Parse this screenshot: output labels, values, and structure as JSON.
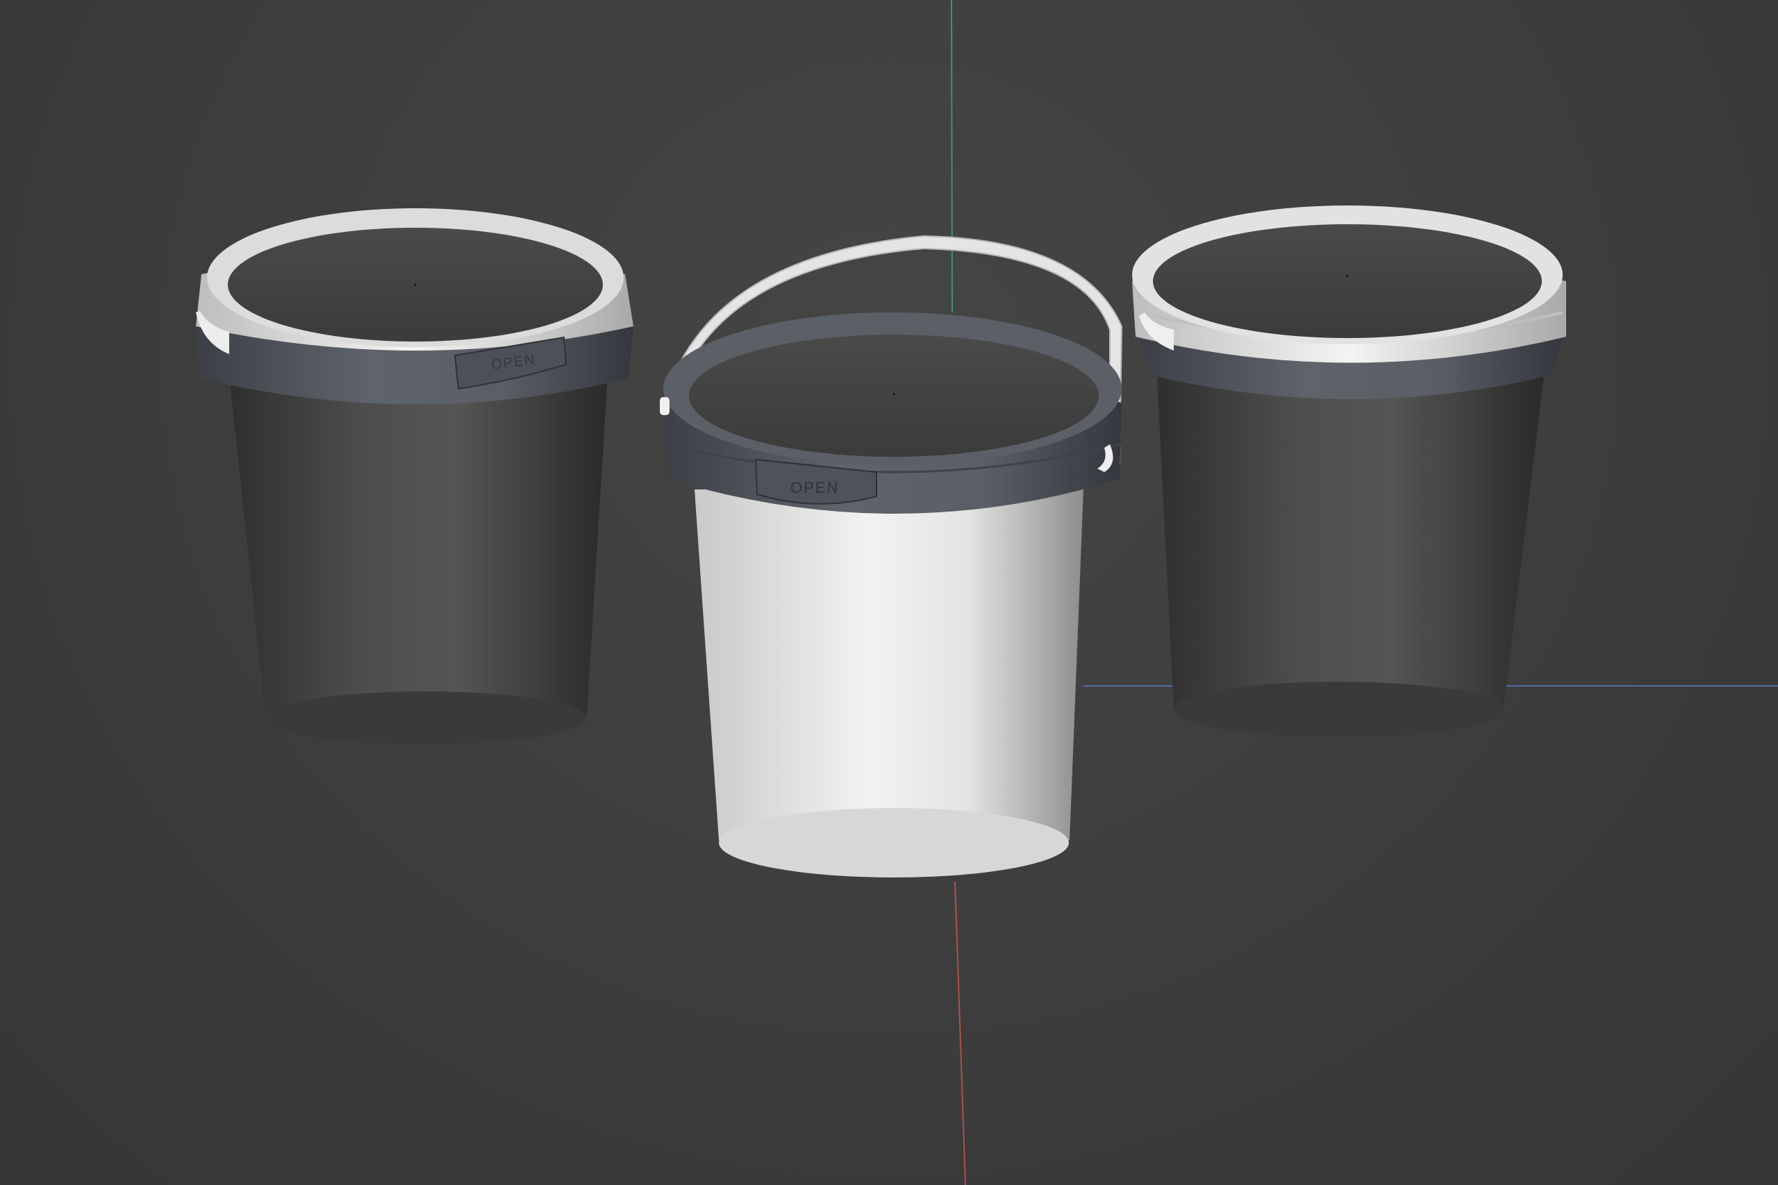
{
  "viewport": {
    "background": "#3f3f3f",
    "axis_colors": {
      "y_axis": "#3f8f7f",
      "x_axis": "#4f6fa8",
      "z_axis": "#b0504a"
    }
  },
  "objects": [
    {
      "name": "bucket-left",
      "body_color": "#4b4b4b",
      "rim_color": "#5a5f66",
      "lid_ring_color": "#e9e9e9",
      "tab_text": "OPEN"
    },
    {
      "name": "bucket-center",
      "body_color": "#e8e8e8",
      "rim_color": "#565b62",
      "handle_color": "#e2e2e2",
      "tab_text": "OPEN"
    },
    {
      "name": "bucket-right",
      "body_color": "#4b4b4b",
      "rim_color": "#5a5f66",
      "lid_ring_color": "#ececec"
    }
  ]
}
